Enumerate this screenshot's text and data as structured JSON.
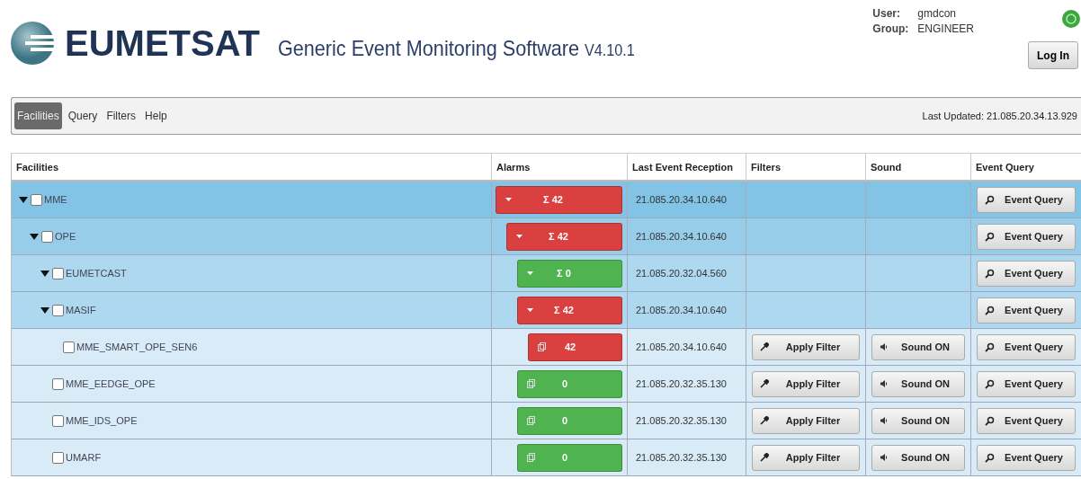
{
  "header": {
    "logo": "EUMETSAT",
    "title": "Generic Event Monitoring Software",
    "version": "V4.10.1",
    "user_label": "User:",
    "user": "gmdcon",
    "group_label": "Group:",
    "group": "ENGINEER",
    "login_button": "Log In"
  },
  "nav": {
    "items": [
      {
        "label": "Facilities",
        "selected": true
      },
      {
        "label": "Query",
        "selected": false
      },
      {
        "label": "Filters",
        "selected": false
      },
      {
        "label": "Help",
        "selected": false
      }
    ],
    "last_updated": "Last Updated: 21.085.20.34.13.929"
  },
  "table": {
    "columns": [
      "Facilities",
      "Alarms",
      "Last Event Reception",
      "Filters",
      "Sound",
      "Event Query"
    ],
    "rows": [
      {
        "name": "MME",
        "checked": false,
        "expanded": true,
        "alarm": {
          "label": "Σ 42",
          "color": "#d9403f"
        },
        "last_event": "21.085.20.34.10.640",
        "query_button": "Event Query",
        "children": [
          {
            "name": "OPE",
            "checked": false,
            "expanded": true,
            "alarm": {
              "label": "Σ 42",
              "color": "#d9403f"
            },
            "last_event": "21.085.20.34.10.640",
            "query_button": "Event Query",
            "children": [
              {
                "name": "EUMETCAST",
                "checked": false,
                "expanded": true,
                "alarm": {
                  "label": "Σ 0",
                  "color": "#4fb34f"
                },
                "last_event": "21.085.20.32.04.560",
                "query_button": "Event Query"
              },
              {
                "name": "MASIF",
                "checked": false,
                "expanded": true,
                "alarm": {
                  "label": "Σ 42",
                  "color": "#d9403f"
                },
                "last_event": "21.085.20.34.10.640",
                "query_button": "Event Query",
                "children": [
                  {
                    "name": "MME_SMART_OPE_SEN6",
                    "checked": false,
                    "alarm": {
                      "label": "42",
                      "color": "#d9403f"
                    },
                    "last_event": "21.085.20.34.10.640",
                    "filter_button": "Apply Filter",
                    "sound_button": "Sound ON",
                    "query_button": "Event Query"
                  }
                ]
              },
              {
                "name": "MME_EEDGE_OPE",
                "checked": false,
                "alarm": {
                  "label": "0",
                  "color": "#4fb34f"
                },
                "last_event": "21.085.20.32.35.130",
                "filter_button": "Apply Filter",
                "sound_button": "Sound ON",
                "query_button": "Event Query"
              },
              {
                "name": "MME_IDS_OPE",
                "checked": false,
                "alarm": {
                  "label": "0",
                  "color": "#4fb34f"
                },
                "last_event": "21.085.20.32.35.130",
                "filter_button": "Apply Filter",
                "sound_button": "Sound ON",
                "query_button": "Event Query"
              },
              {
                "name": "UMARF",
                "checked": false,
                "alarm": {
                  "label": "0",
                  "color": "#4fb34f"
                },
                "last_event": "21.085.20.32.35.130",
                "filter_button": "Apply Filter",
                "sound_button": "Sound ON",
                "query_button": "Event Query"
              }
            ]
          }
        ]
      }
    ]
  }
}
